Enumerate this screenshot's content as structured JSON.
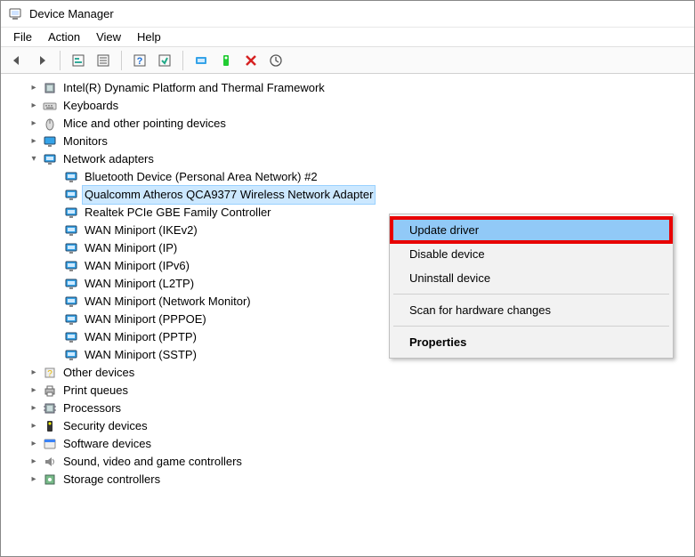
{
  "window": {
    "title": "Device Manager"
  },
  "menu": {
    "file": "File",
    "action": "Action",
    "view": "View",
    "help": "Help"
  },
  "tree": {
    "cat": {
      "dpt": "Intel(R) Dynamic Platform and Thermal Framework",
      "keyboards": "Keyboards",
      "mice": "Mice and other pointing devices",
      "monitors": "Monitors",
      "network": "Network adapters",
      "other": "Other devices",
      "printq": "Print queues",
      "processors": "Processors",
      "security": "Security devices",
      "software": "Software devices",
      "sound": "Sound, video and game controllers",
      "storage": "Storage controllers"
    },
    "net": {
      "bt": "Bluetooth Device (Personal Area Network) #2",
      "qca": "Qualcomm Atheros QCA9377 Wireless Network Adapter",
      "realtek": "Realtek PCIe GBE Family Controller",
      "wan_ikev2": "WAN Miniport (IKEv2)",
      "wan_ip": "WAN Miniport (IP)",
      "wan_ipv6": "WAN Miniport (IPv6)",
      "wan_l2tp": "WAN Miniport (L2TP)",
      "wan_netmon": "WAN Miniport (Network Monitor)",
      "wan_pppoe": "WAN Miniport (PPPOE)",
      "wan_pptp": "WAN Miniport (PPTP)",
      "wan_sstp": "WAN Miniport (SSTP)"
    }
  },
  "context": {
    "update": "Update driver",
    "disable": "Disable device",
    "uninstall": "Uninstall device",
    "scan": "Scan for hardware changes",
    "properties": "Properties"
  }
}
